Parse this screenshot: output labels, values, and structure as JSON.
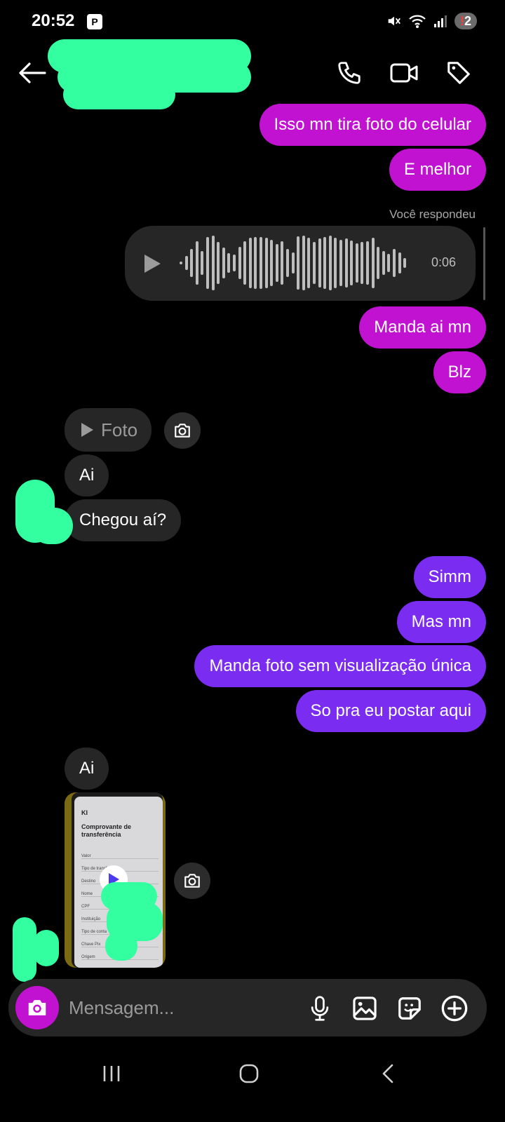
{
  "status_bar": {
    "time": "20:52",
    "notification_badge": "2",
    "badge_prefix": "!"
  },
  "header": {
    "back_icon": "arrow-left-icon",
    "actions": [
      "phone-icon",
      "video-icon",
      "tag-icon"
    ]
  },
  "messages": {
    "m1": "Isso mn tira foto do celular",
    "m2": "E melhor",
    "reply_label": "Você respondeu",
    "voice_duration": "0:06",
    "m3": "Manda ai mn",
    "m4": "Blz",
    "photo_label": "Foto",
    "m5": "Ai",
    "m6": "Chegou aí?",
    "m7": "Simm",
    "m8": "Mas mn",
    "m9": "Manda foto sem visualização única",
    "m10": "So pra eu postar aqui",
    "m11": "Ai"
  },
  "video_thumb": {
    "title": "Comprovante de transferência",
    "rows": [
      "Valor",
      "Tipo de transf.",
      "Destino",
      "Nome",
      "CPF",
      "Instituição",
      "Tipo de conta",
      "Chave Pix",
      "Origem"
    ]
  },
  "composer": {
    "placeholder": "Mensagem..."
  },
  "colors": {
    "outgoing_magenta": "#c012d0",
    "outgoing_purple": "#7a2cf0",
    "incoming": "#262626",
    "redaction": "#33ffa0"
  }
}
